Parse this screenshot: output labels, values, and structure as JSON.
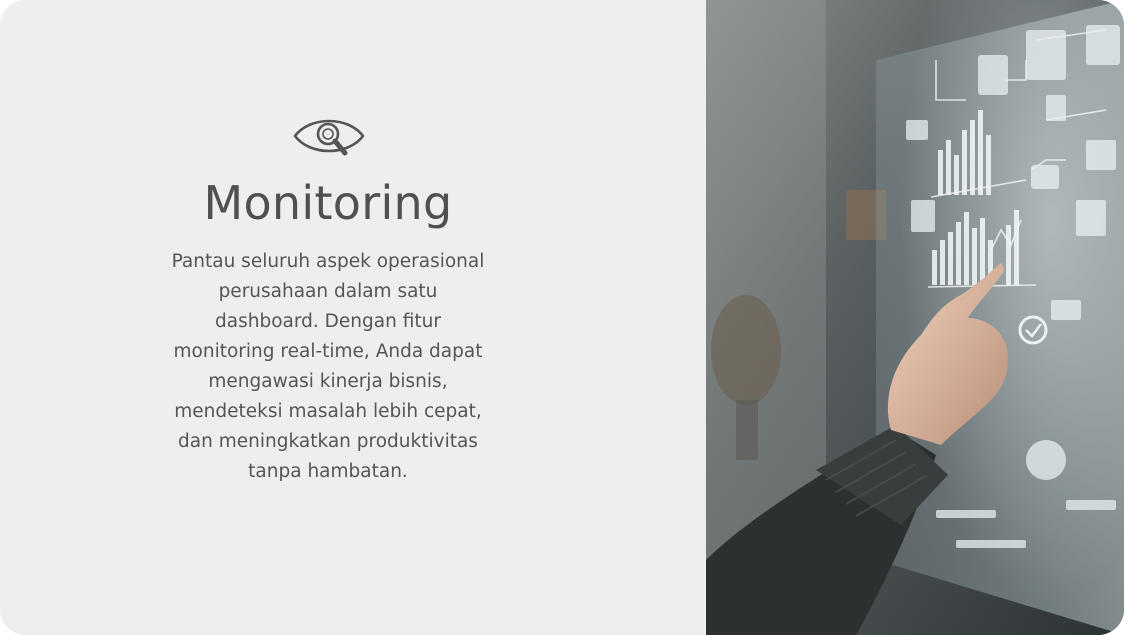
{
  "feature": {
    "icon": "eye-search-icon",
    "title": "Monitoring",
    "description": "Pantau seluruh aspek operasional perusahaan dalam satu dashboard. Dengan fitur monitoring real-time, Anda dapat mengawasi kinerja bisnis, mendeteksi masalah lebih cepat, dan meningkatkan produktivitas tanpa hambatan."
  },
  "image": {
    "subject": "hand-touching-holographic-dashboard"
  },
  "colors": {
    "panel_background": "#eeeeee",
    "title_text": "#505050",
    "body_text": "#555555"
  }
}
